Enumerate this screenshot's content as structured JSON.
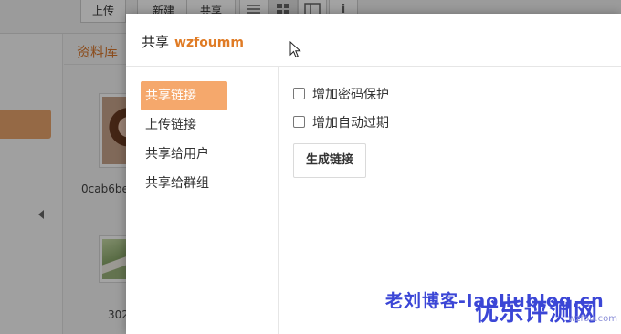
{
  "toolbar": {
    "upload_label": "上传",
    "new_label": "新建",
    "share_label": "共享",
    "info_label": "i"
  },
  "library": {
    "title": "资料库",
    "files": [
      {
        "name": "0cab6be"
      },
      {
        "name": "302"
      }
    ]
  },
  "dialog": {
    "title": "共享",
    "file_name": "wzfoumm",
    "tabs": [
      {
        "label": "共享链接",
        "active": true
      },
      {
        "label": "上传链接",
        "active": false
      },
      {
        "label": "共享给用户",
        "active": false
      },
      {
        "label": "共享给群组",
        "active": false
      }
    ],
    "options": [
      {
        "label": "增加密码保护",
        "checked": false
      },
      {
        "label": "增加自动过期",
        "checked": false
      }
    ],
    "generate_label": "生成链接"
  },
  "watermark": {
    "line1": "老刘博客-laoliublog.cn",
    "line2": "优乐评测网",
    "line3": "wzfou.com"
  },
  "colors": {
    "accent": "#f5a86c",
    "filename": "#e07b24",
    "watermark": "#3b46d6"
  }
}
